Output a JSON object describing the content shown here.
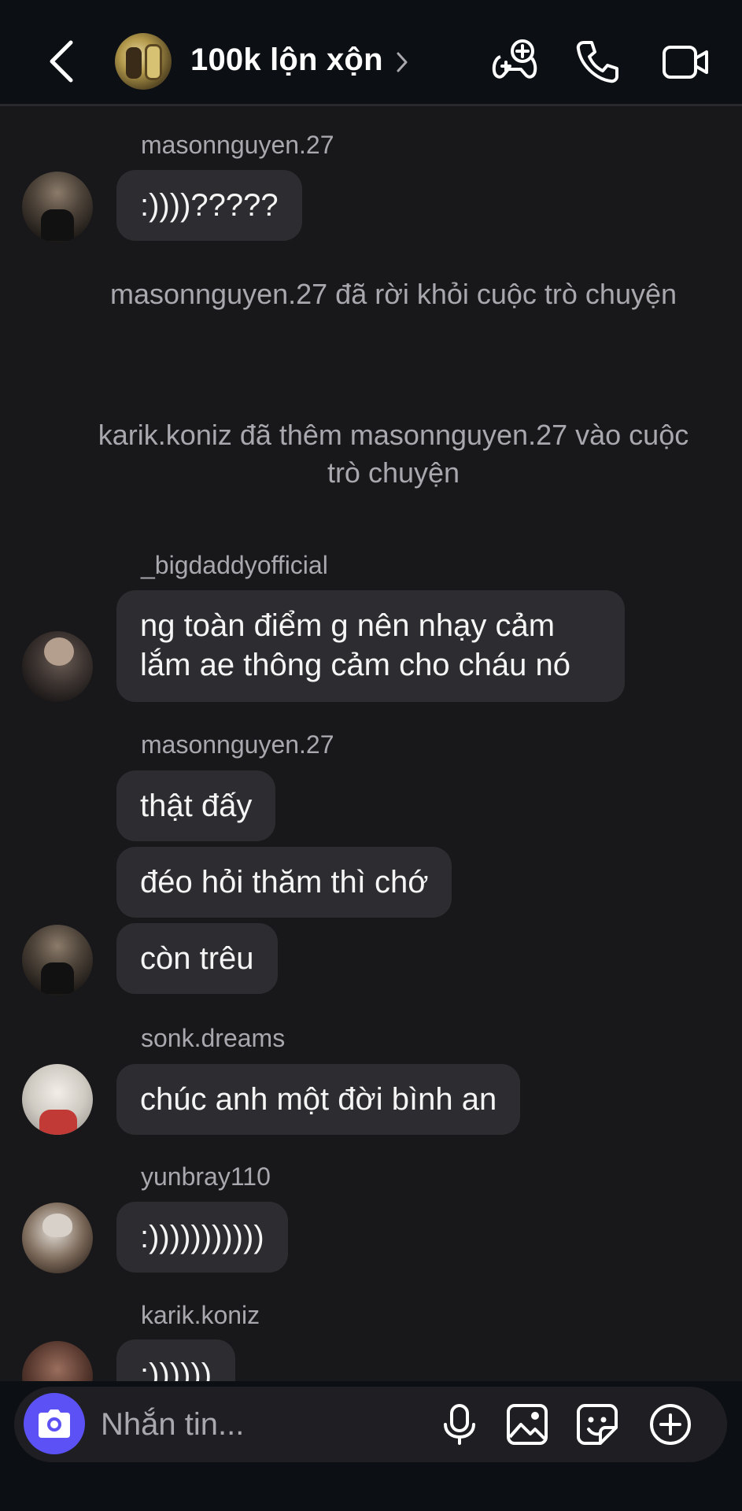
{
  "header": {
    "title": "100k lộn xộn"
  },
  "messages": {
    "m1": {
      "sender": "masonnguyen.27",
      "text": ":))))?????"
    },
    "sys1": "masonnguyen.27 đã rời khỏi cuộc trò chuyện",
    "sys2": "karik.koniz đã thêm masonnguyen.27 vào cuộc trò chuyện",
    "m2": {
      "sender": "_bigdaddyofficial",
      "text": "ng toàn điểm g nên nhạy cảm lắm ae thông cảm cho cháu nó"
    },
    "m3": {
      "sender": "masonnguyen.27",
      "texts": [
        "thật đấy",
        "đéo hỏi thăm thì chớ",
        "còn trêu"
      ]
    },
    "m4": {
      "sender": "sonk.dreams",
      "text": "chúc anh một đời bình an"
    },
    "m5": {
      "sender": "yunbray110",
      "text": ":)))))))))))"
    },
    "m6": {
      "sender": "karik.koniz",
      "text": ":))))))"
    }
  },
  "composer": {
    "placeholder": "Nhắn tin..."
  },
  "colors": {
    "background": "#18181b",
    "header_bg": "#0c0f14",
    "bubble": "#2d2d31",
    "camera_accent": "#5b51f5",
    "muted_text": "#a8a8ae"
  },
  "icons": {
    "header": [
      "back-icon",
      "games-icon",
      "phone-icon",
      "video-camera-icon"
    ],
    "composer": [
      "camera-icon",
      "microphone-icon",
      "gallery-icon",
      "sticker-icon",
      "plus-icon"
    ]
  }
}
